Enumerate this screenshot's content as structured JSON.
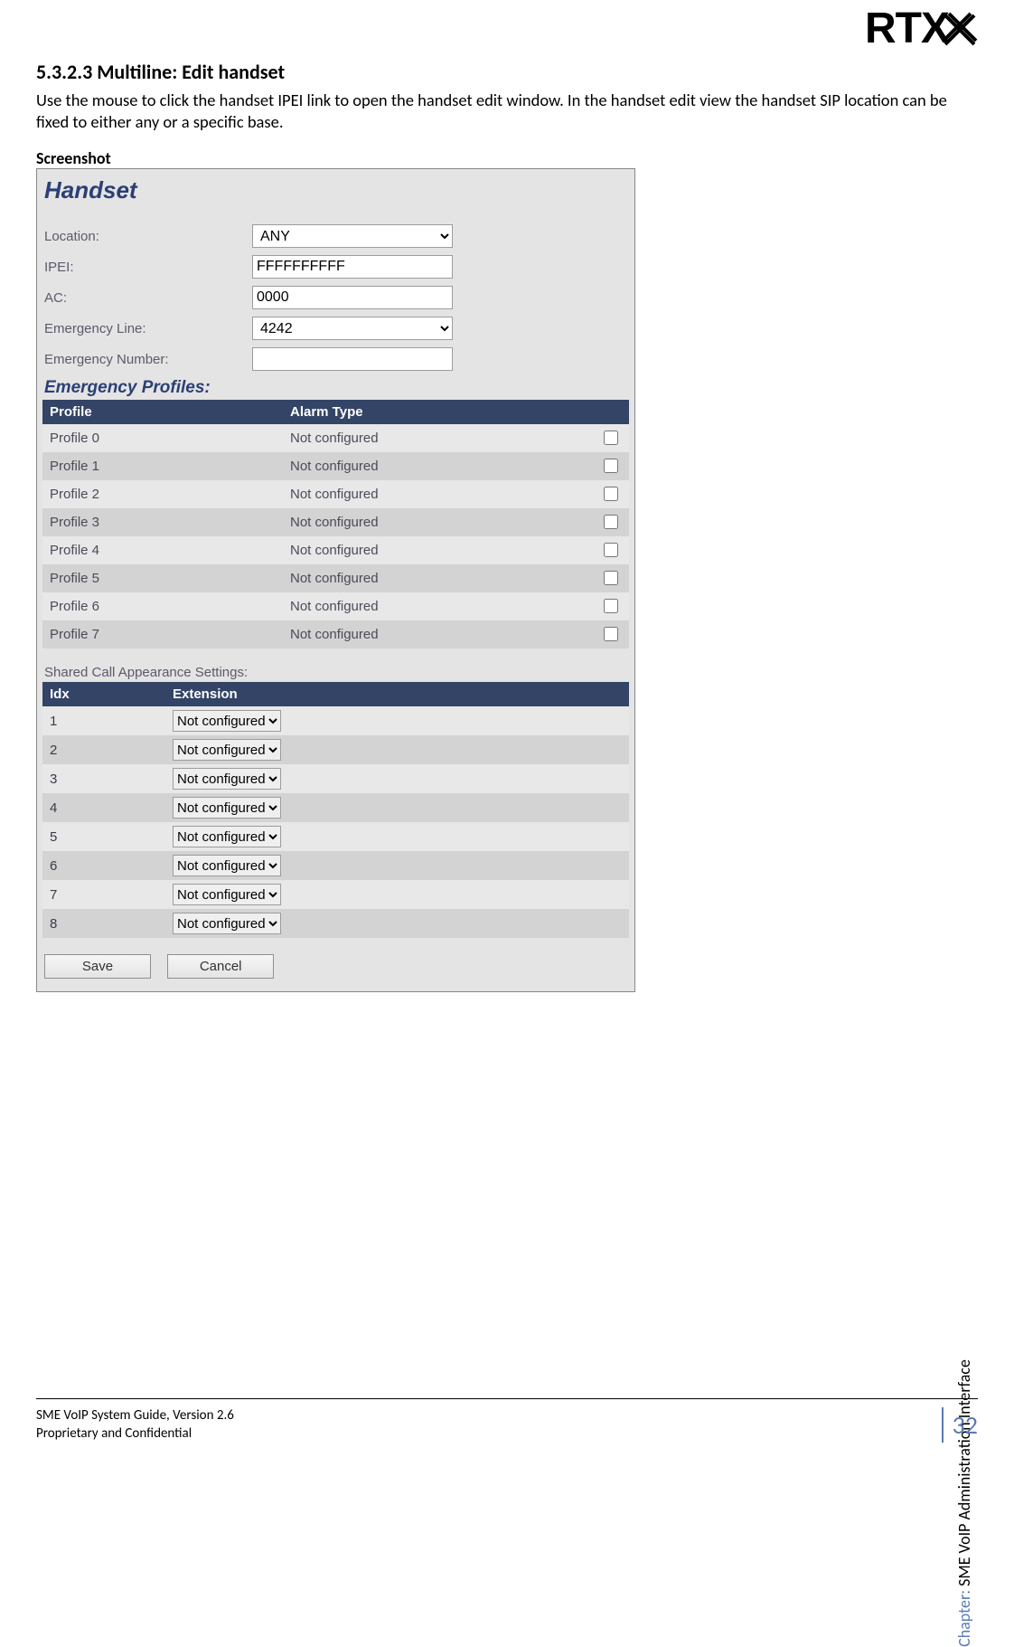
{
  "logo": "RTX",
  "section": {
    "number_title": "5.3.2.3 Multiline: Edit handset",
    "body": "Use the mouse to click the handset IPEI link to open the handset edit window. In the handset edit view the handset SIP location can be fixed to either any or a specific base.",
    "screenshot_label": "Screenshot"
  },
  "shot": {
    "title": "Handset",
    "fields": {
      "location_label": "Location:",
      "location_value": "ANY",
      "ipei_label": "IPEI:",
      "ipei_value": "FFFFFFFFFF",
      "ac_label": "AC:",
      "ac_value": "0000",
      "emergency_line_label": "Emergency Line:",
      "emergency_line_value": "4242",
      "emergency_number_label": "Emergency Number:",
      "emergency_number_value": ""
    },
    "emergency_profiles_heading": "Emergency Profiles:",
    "profiles_headers": {
      "profile": "Profile",
      "alarm": "Alarm Type",
      "blank": ""
    },
    "profiles": [
      {
        "name": "Profile 0",
        "alarm": "Not configured",
        "checked": false
      },
      {
        "name": "Profile 1",
        "alarm": "Not configured",
        "checked": false
      },
      {
        "name": "Profile 2",
        "alarm": "Not configured",
        "checked": false
      },
      {
        "name": "Profile 3",
        "alarm": "Not configured",
        "checked": false
      },
      {
        "name": "Profile 4",
        "alarm": "Not configured",
        "checked": false
      },
      {
        "name": "Profile 5",
        "alarm": "Not configured",
        "checked": false
      },
      {
        "name": "Profile 6",
        "alarm": "Not configured",
        "checked": false
      },
      {
        "name": "Profile 7",
        "alarm": "Not configured",
        "checked": false
      }
    ],
    "sca_label": "Shared Call Appearance Settings:",
    "sca_headers": {
      "idx": "Idx",
      "ext": "Extension"
    },
    "sca": [
      {
        "idx": "1",
        "ext": "Not configured"
      },
      {
        "idx": "2",
        "ext": "Not configured"
      },
      {
        "idx": "3",
        "ext": "Not configured"
      },
      {
        "idx": "4",
        "ext": "Not configured"
      },
      {
        "idx": "5",
        "ext": "Not configured"
      },
      {
        "idx": "6",
        "ext": "Not configured"
      },
      {
        "idx": "7",
        "ext": "Not configured"
      },
      {
        "idx": "8",
        "ext": "Not configured"
      }
    ],
    "buttons": {
      "save": "Save",
      "cancel": "Cancel"
    }
  },
  "sidebar": {
    "chapter_prefix": "Chapter:",
    "chapter_name": " SME VoIP Administration Interface"
  },
  "footer": {
    "line1": "SME VoIP System Guide, Version 2.6",
    "line2": "Proprietary and Confidential",
    "page": "32"
  }
}
